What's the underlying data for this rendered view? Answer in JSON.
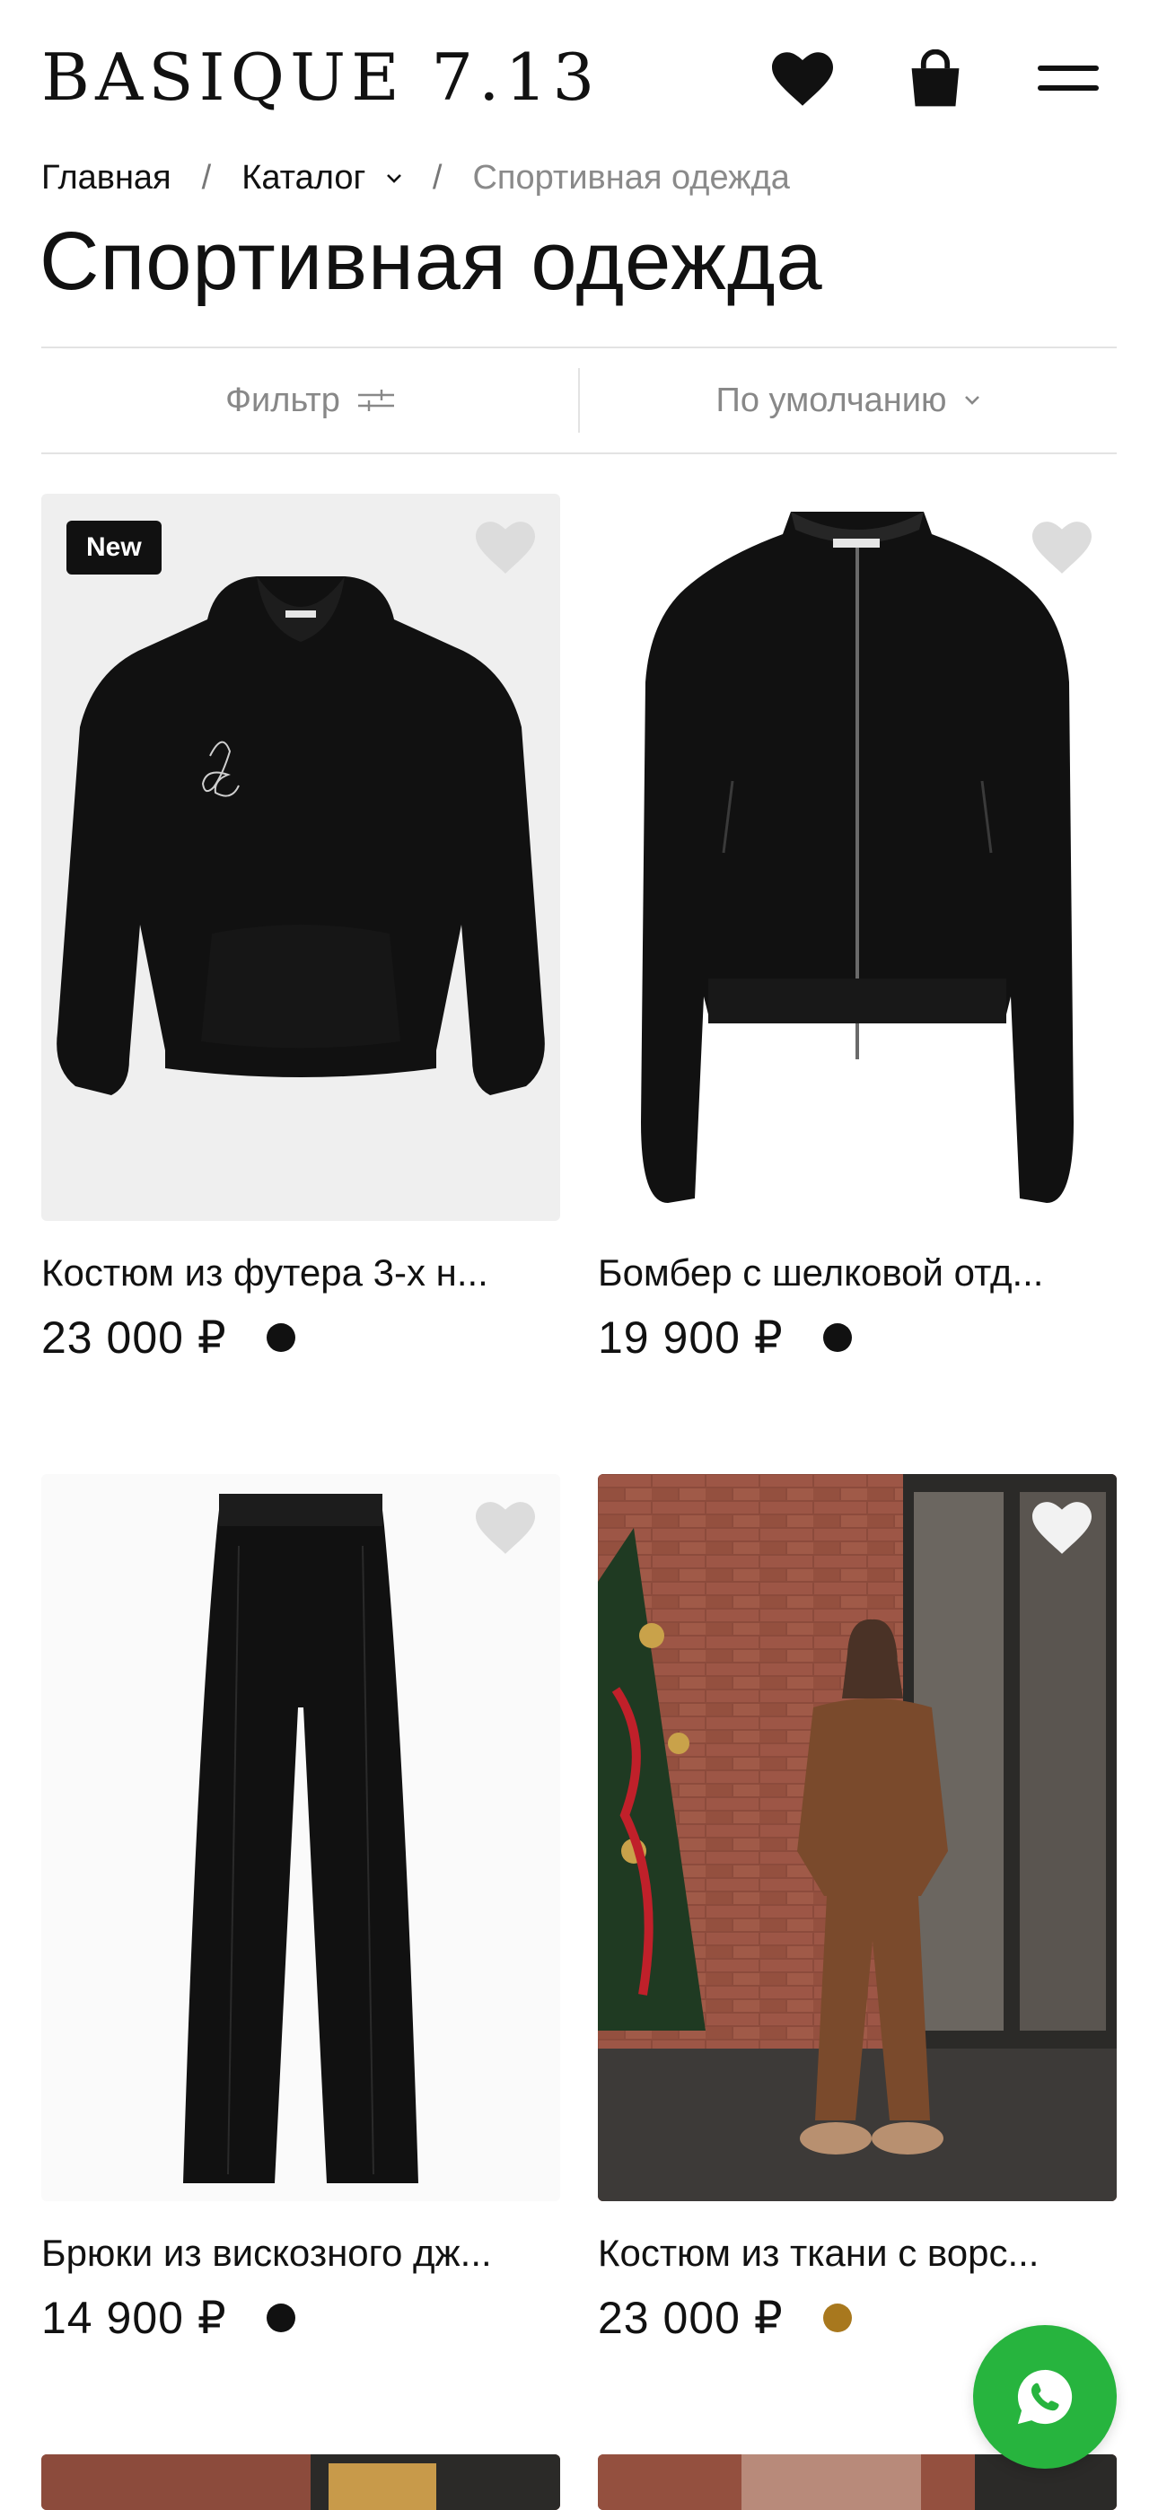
{
  "header": {
    "logo": "BASIQUE 7.13"
  },
  "breadcrumb": {
    "home": "Главная",
    "catalog": "Каталог",
    "current": "Спортивная одежда"
  },
  "page_title": "Спортивная одежда",
  "filterbar": {
    "filter_label": "Фильтр",
    "sort_label": "По умолчанию"
  },
  "products": [
    {
      "name": "Костюм из футера 3-х н...",
      "price": "23 000 ₽",
      "badge": "New",
      "swatch": "#111111",
      "image": "black-hoodie"
    },
    {
      "name": "Бомбер с шелковой отд...",
      "price": "19 900 ₽",
      "badge": "",
      "swatch": "#111111",
      "image": "black-bomber"
    },
    {
      "name": "Брюки из вискозного дж...",
      "price": "14 900 ₽",
      "badge": "",
      "swatch": "#111111",
      "image": "black-trousers"
    },
    {
      "name": "Костюм из ткани с ворс...",
      "price": "23 000 ₽",
      "badge": "",
      "swatch": "#a8781e",
      "image": "brown-suit-photo"
    }
  ],
  "icons": {
    "favorites": "heart-icon",
    "cart": "bag-icon",
    "menu": "hamburger-icon",
    "filter": "sliders-icon",
    "sort": "chevron-down-icon",
    "chat": "whatsapp-icon"
  },
  "colors": {
    "accent_green": "#27b43e",
    "text": "#111111",
    "muted": "#888888"
  }
}
